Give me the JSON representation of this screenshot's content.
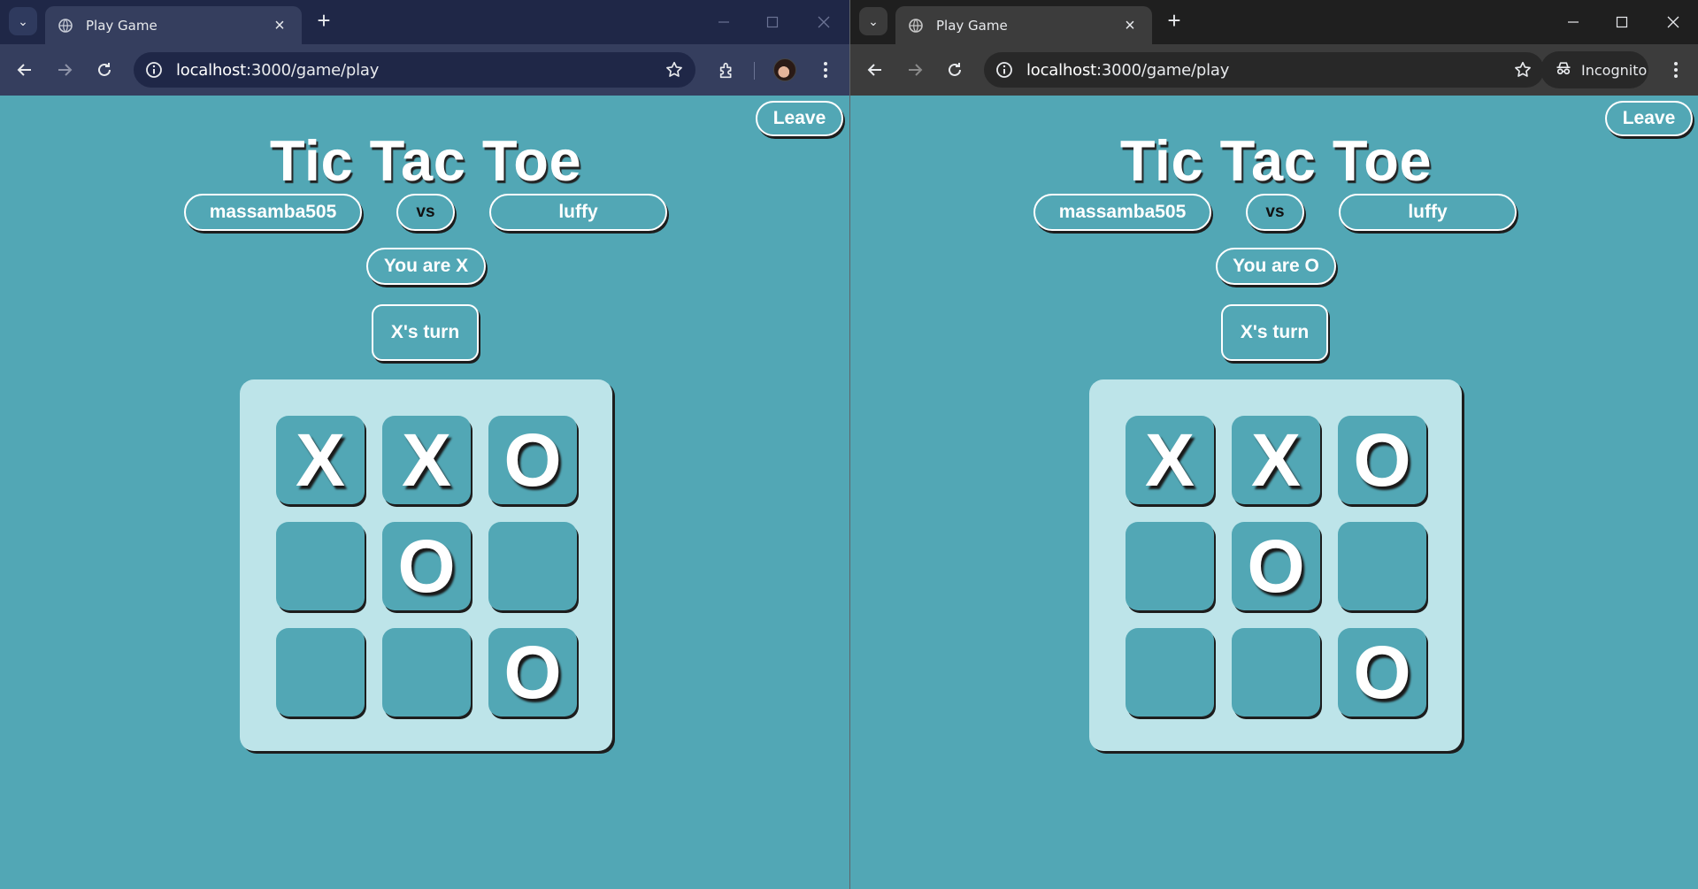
{
  "windows": [
    {
      "tab_title": "Play Game",
      "url_host": "localhost",
      "url_rest": ":3000/game/play",
      "player1": "massamba505",
      "vs": "vs",
      "player2": "luffy",
      "you_are": "You are X",
      "turn": "X's turn",
      "leave": "Leave",
      "title": "Tic Tac Toe",
      "board": [
        "X",
        "X",
        "O",
        "",
        "O",
        "",
        "",
        "",
        "O"
      ]
    },
    {
      "tab_title": "Play Game",
      "url_host": "localhost",
      "url_rest": ":3000/game/play",
      "incognito_label": "Incognito",
      "player1": "massamba505",
      "vs": "vs",
      "player2": "luffy",
      "you_are": "You are O",
      "turn": "X's turn",
      "leave": "Leave",
      "title": "Tic Tac Toe",
      "board": [
        "X",
        "X",
        "O",
        "",
        "O",
        "",
        "",
        "",
        "O"
      ]
    }
  ],
  "colors": {
    "page_bg": "#52a7b5",
    "board_bg": "#bde4e9",
    "normal_frame": "#1f2747",
    "incognito_frame": "#1f1f1f"
  }
}
